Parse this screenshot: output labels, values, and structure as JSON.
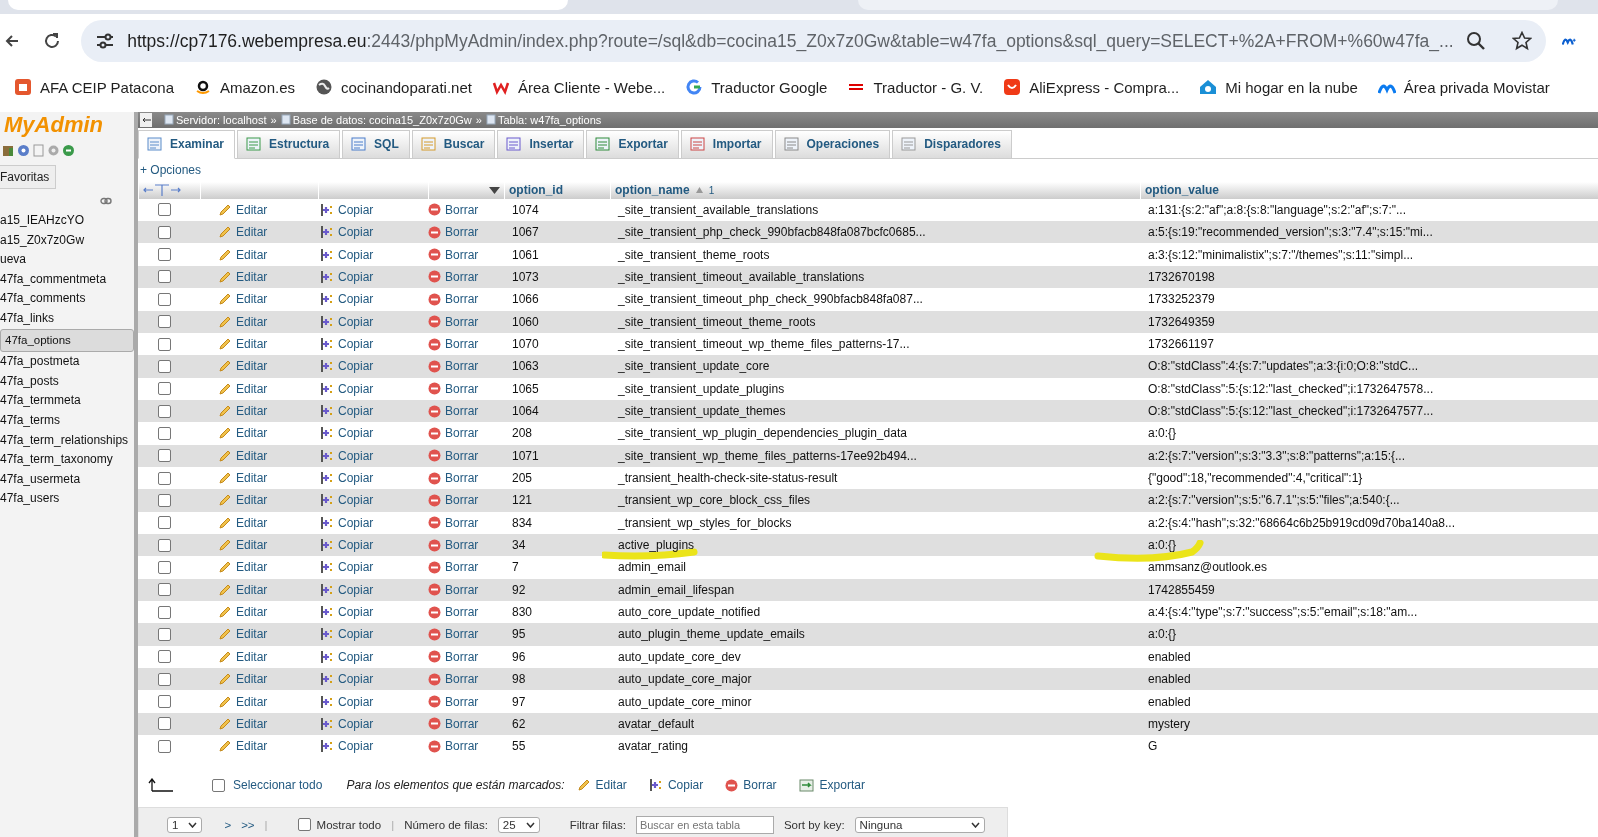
{
  "browser": {
    "url_host": "https://cp7176.webempresa.eu",
    "url_rest": ":2443/phpMyAdmin/index.php?route=/sql&db=cocina15_Z0x7z0Gw&table=w47fa_options&sql_query=SELECT+%2A+FROM+%60w47fa_...",
    "bookmarks": [
      {
        "label": "AFA CEIP Patacona"
      },
      {
        "label": "Amazon.es"
      },
      {
        "label": "cocinandoparati.net"
      },
      {
        "label": "Área Cliente - Webe..."
      },
      {
        "label": "Traductor Google"
      },
      {
        "label": "Traductor - G. V."
      },
      {
        "label": "AliExpress - Compra..."
      },
      {
        "label": "Mi hogar en la nube"
      },
      {
        "label": "Área privada Movistar"
      }
    ]
  },
  "sidebar": {
    "logo": "MyAdmin",
    "favorites_button": "Favoritas",
    "items": [
      {
        "label": "a15_IEAHzcYO",
        "selected": false
      },
      {
        "label": "a15_Z0x7z0Gw",
        "selected": false
      },
      {
        "label": "ueva",
        "selected": false
      },
      {
        "label": "47fa_commentmeta",
        "selected": false
      },
      {
        "label": "47fa_comments",
        "selected": false
      },
      {
        "label": "47fa_links",
        "selected": false
      },
      {
        "label": "47fa_options",
        "selected": true
      },
      {
        "label": "47fa_postmeta",
        "selected": false
      },
      {
        "label": "47fa_posts",
        "selected": false
      },
      {
        "label": "47fa_termmeta",
        "selected": false
      },
      {
        "label": "47fa_terms",
        "selected": false
      },
      {
        "label": "47fa_term_relationships",
        "selected": false
      },
      {
        "label": "47fa_term_taxonomy",
        "selected": false
      },
      {
        "label": "47fa_usermeta",
        "selected": false
      },
      {
        "label": "47fa_users",
        "selected": false
      }
    ]
  },
  "breadcrumb": [
    {
      "label": "Servidor: localhost"
    },
    {
      "label": "Base de datos: cocina15_Z0x7z0Gw"
    },
    {
      "label": "Tabla: w47fa_options"
    }
  ],
  "breadcrumb_separator": "»",
  "tabs": [
    {
      "label": "Examinar",
      "selected": true
    },
    {
      "label": "Estructura",
      "selected": false
    },
    {
      "label": "SQL",
      "selected": false
    },
    {
      "label": "Buscar",
      "selected": false
    },
    {
      "label": "Insertar",
      "selected": false
    },
    {
      "label": "Exportar",
      "selected": false
    },
    {
      "label": "Importar",
      "selected": false
    },
    {
      "label": "Operaciones",
      "selected": false
    },
    {
      "label": "Disparadores",
      "selected": false
    }
  ],
  "options_link": "+ Opciones",
  "table": {
    "columns": [
      {
        "label": "option_id"
      },
      {
        "label": "option_name",
        "sort_order": "1"
      },
      {
        "label": "option_value"
      }
    ],
    "rows": [
      {
        "checked": false,
        "highlighted": false,
        "edit": "Editar",
        "copy": "Copiar",
        "delete": "Borrar",
        "option_id": "1074",
        "option_name": "_site_transient_available_translations",
        "option_value": "a:131:{s:2:\"af\";a:8:{s:8:\"language\";s:2:\"af\";s:7:\"..."
      },
      {
        "checked": false,
        "highlighted": false,
        "edit": "Editar",
        "copy": "Copiar",
        "delete": "Borrar",
        "option_id": "1067",
        "option_name": "_site_transient_php_check_990bfacb848fa087bcfc0685...",
        "option_value": "a:5:{s:19:\"recommended_version\";s:3:\"7.4\";s:15:\"mi..."
      },
      {
        "checked": false,
        "highlighted": false,
        "edit": "Editar",
        "copy": "Copiar",
        "delete": "Borrar",
        "option_id": "1061",
        "option_name": "_site_transient_theme_roots",
        "option_value": "a:3:{s:12:\"minimalistix\";s:7:\"/themes\";s:11:\"simpl..."
      },
      {
        "checked": false,
        "highlighted": false,
        "edit": "Editar",
        "copy": "Copiar",
        "delete": "Borrar",
        "option_id": "1073",
        "option_name": "_site_transient_timeout_available_translations",
        "option_value": "1732670198"
      },
      {
        "checked": false,
        "highlighted": false,
        "edit": "Editar",
        "copy": "Copiar",
        "delete": "Borrar",
        "option_id": "1066",
        "option_name": "_site_transient_timeout_php_check_990bfacb848fa087...",
        "option_value": "1733252379"
      },
      {
        "checked": false,
        "highlighted": false,
        "edit": "Editar",
        "copy": "Copiar",
        "delete": "Borrar",
        "option_id": "1060",
        "option_name": "_site_transient_timeout_theme_roots",
        "option_value": "1732649359"
      },
      {
        "checked": false,
        "highlighted": false,
        "edit": "Editar",
        "copy": "Copiar",
        "delete": "Borrar",
        "option_id": "1070",
        "option_name": "_site_transient_timeout_wp_theme_files_patterns-17...",
        "option_value": "1732661197"
      },
      {
        "checked": false,
        "highlighted": false,
        "edit": "Editar",
        "copy": "Copiar",
        "delete": "Borrar",
        "option_id": "1063",
        "option_name": "_site_transient_update_core",
        "option_value": "O:8:\"stdClass\":4:{s:7:\"updates\";a:3:{i:0;O:8:\"stdC..."
      },
      {
        "checked": false,
        "highlighted": false,
        "edit": "Editar",
        "copy": "Copiar",
        "delete": "Borrar",
        "option_id": "1065",
        "option_name": "_site_transient_update_plugins",
        "option_value": "O:8:\"stdClass\":5:{s:12:\"last_checked\";i:1732647578..."
      },
      {
        "checked": false,
        "highlighted": false,
        "edit": "Editar",
        "copy": "Copiar",
        "delete": "Borrar",
        "option_id": "1064",
        "option_name": "_site_transient_update_themes",
        "option_value": "O:8:\"stdClass\":5:{s:12:\"last_checked\";i:1732647577..."
      },
      {
        "checked": false,
        "highlighted": false,
        "edit": "Editar",
        "copy": "Copiar",
        "delete": "Borrar",
        "option_id": "208",
        "option_name": "_site_transient_wp_plugin_dependencies_plugin_data",
        "option_value": "a:0:{}"
      },
      {
        "checked": false,
        "highlighted": false,
        "edit": "Editar",
        "copy": "Copiar",
        "delete": "Borrar",
        "option_id": "1071",
        "option_name": "_site_transient_wp_theme_files_patterns-17ee92b494...",
        "option_value": "a:2:{s:7:\"version\";s:3:\"3.3\";s:8:\"patterns\";a:15:{..."
      },
      {
        "checked": false,
        "highlighted": false,
        "edit": "Editar",
        "copy": "Copiar",
        "delete": "Borrar",
        "option_id": "205",
        "option_name": "_transient_health-check-site-status-result",
        "option_value": "{\"good\":18,\"recommended\":4,\"critical\":1}"
      },
      {
        "checked": false,
        "highlighted": false,
        "edit": "Editar",
        "copy": "Copiar",
        "delete": "Borrar",
        "option_id": "121",
        "option_name": "_transient_wp_core_block_css_files",
        "option_value": "a:2:{s:7:\"version\";s:5:\"6.7.1\";s:5:\"files\";a:540:{..."
      },
      {
        "checked": false,
        "highlighted": false,
        "edit": "Editar",
        "copy": "Copiar",
        "delete": "Borrar",
        "option_id": "834",
        "option_name": "_transient_wp_styles_for_blocks",
        "option_value": "a:2:{s:4:\"hash\";s:32:\"68664c6b25b919cd09d70ba140a8..."
      },
      {
        "checked": false,
        "highlighted": true,
        "edit": "Editar",
        "copy": "Copiar",
        "delete": "Borrar",
        "option_id": "34",
        "option_name": "active_plugins",
        "option_value": "a:0:{}"
      },
      {
        "checked": false,
        "highlighted": false,
        "edit": "Editar",
        "copy": "Copiar",
        "delete": "Borrar",
        "option_id": "7",
        "option_name": "admin_email",
        "option_value": "ammsanz@outlook.es"
      },
      {
        "checked": false,
        "highlighted": false,
        "edit": "Editar",
        "copy": "Copiar",
        "delete": "Borrar",
        "option_id": "92",
        "option_name": "admin_email_lifespan",
        "option_value": "1742855459"
      },
      {
        "checked": false,
        "highlighted": false,
        "edit": "Editar",
        "copy": "Copiar",
        "delete": "Borrar",
        "option_id": "830",
        "option_name": "auto_core_update_notified",
        "option_value": "a:4:{s:4:\"type\";s:7:\"success\";s:5:\"email\";s:18:\"am..."
      },
      {
        "checked": false,
        "highlighted": false,
        "edit": "Editar",
        "copy": "Copiar",
        "delete": "Borrar",
        "option_id": "95",
        "option_name": "auto_plugin_theme_update_emails",
        "option_value": "a:0:{}"
      },
      {
        "checked": false,
        "highlighted": false,
        "edit": "Editar",
        "copy": "Copiar",
        "delete": "Borrar",
        "option_id": "96",
        "option_name": "auto_update_core_dev",
        "option_value": "enabled"
      },
      {
        "checked": false,
        "highlighted": false,
        "edit": "Editar",
        "copy": "Copiar",
        "delete": "Borrar",
        "option_id": "98",
        "option_name": "auto_update_core_major",
        "option_value": "enabled"
      },
      {
        "checked": false,
        "highlighted": false,
        "edit": "Editar",
        "copy": "Copiar",
        "delete": "Borrar",
        "option_id": "97",
        "option_name": "auto_update_core_minor",
        "option_value": "enabled"
      },
      {
        "checked": false,
        "highlighted": false,
        "edit": "Editar",
        "copy": "Copiar",
        "delete": "Borrar",
        "option_id": "62",
        "option_name": "avatar_default",
        "option_value": "mystery"
      },
      {
        "checked": false,
        "highlighted": false,
        "edit": "Editar",
        "copy": "Copiar",
        "delete": "Borrar",
        "option_id": "55",
        "option_name": "avatar_rating",
        "option_value": "G"
      }
    ]
  },
  "footer": {
    "select_all": {
      "label": "Seleccionar todo",
      "checked": false
    },
    "with_selected": "Para los elementos que están marcados:",
    "actions": [
      {
        "kind": "edit",
        "label": "Editar"
      },
      {
        "kind": "copy",
        "label": "Copiar"
      },
      {
        "kind": "delete",
        "label": "Borrar"
      },
      {
        "kind": "export",
        "label": "Exportar"
      }
    ]
  },
  "navigation": {
    "separator": "|",
    "page": "1",
    "next": ">",
    "last": ">>",
    "show_all": {
      "label": "Mostrar todo",
      "checked": false
    },
    "rows_label": "Número de filas:",
    "rows_value": "25",
    "filter_label": "Filtrar filas:",
    "filter_placeholder": "Buscar en esta tabla",
    "sort_label": "Sort by key:",
    "sort_value": "Ninguna"
  }
}
